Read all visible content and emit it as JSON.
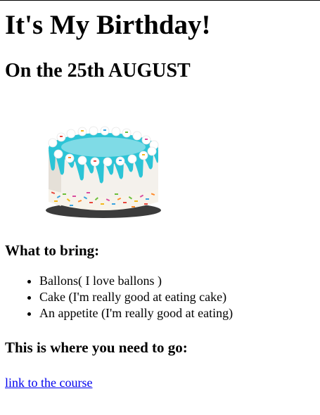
{
  "page": {
    "title": "It's My Birthday!",
    "date_heading": "On the 25th AUGUST"
  },
  "image": {
    "icon": "birthday-cake-image",
    "colors": {
      "frosting": "#ffffff",
      "drip": "#2cc4d6",
      "sprinkles": [
        "#e8463c",
        "#f3b81b",
        "#3aa3e0",
        "#6bbf3a",
        "#d94da1",
        "#ff8a2a"
      ],
      "plate": "#3b3b3b"
    }
  },
  "bring": {
    "heading": "What to bring:",
    "items": [
      "Ballons( I love ballons )",
      "Cake (I'm really good at eating cake)",
      "An appetite (I'm really good at eating)"
    ]
  },
  "directions": {
    "heading": "This is where you need to go:",
    "link_label": "link to the course",
    "link_color": "#0000ee"
  }
}
